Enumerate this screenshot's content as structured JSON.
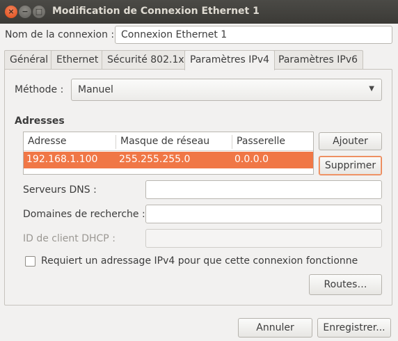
{
  "window": {
    "title": "Modification de Connexion Ethernet 1",
    "close_glyph": "×",
    "minimize_glyph": "−",
    "maximize_glyph": "□"
  },
  "connection": {
    "name_label": "Nom de la connexion :",
    "name_value": "Connexion Ethernet 1"
  },
  "tabs": [
    {
      "label": "Général",
      "active": false
    },
    {
      "label": "Ethernet",
      "active": false
    },
    {
      "label": "Sécurité 802.1x",
      "active": false
    },
    {
      "label": "Paramètres IPv4",
      "active": true
    },
    {
      "label": "Paramètres IPv6",
      "active": false
    }
  ],
  "method": {
    "label": "Méthode :",
    "value": "Manuel",
    "icon": "chevron-down-icon"
  },
  "addresses": {
    "title": "Adresses",
    "columns": [
      "Adresse",
      "Masque de réseau",
      "Passerelle"
    ],
    "rows": [
      {
        "address": "192.168.1.100",
        "netmask": "255.255.255.0",
        "gateway": "0.0.0.0",
        "selected": true
      }
    ],
    "add_button": "Ajouter",
    "delete_button": "Supprimer"
  },
  "dns": {
    "label": "Serveurs DNS :",
    "value": ""
  },
  "search_domains": {
    "label": "Domaines de recherche :",
    "value": ""
  },
  "dhcp_client_id": {
    "label": "ID de client DHCP :",
    "value": "",
    "disabled": true
  },
  "require_ipv4": {
    "label": "Requiert un adressage IPv4 pour que cette connexion fonctionne",
    "checked": false
  },
  "routes_button": "Routes…",
  "footer": {
    "cancel_button": "Annuler",
    "save_button": "Enregistrer..."
  },
  "colors": {
    "selection": "#f07746",
    "titlebar": "#3b3a36",
    "close_button": "#df4a16",
    "focus_border": "#e9804e"
  }
}
